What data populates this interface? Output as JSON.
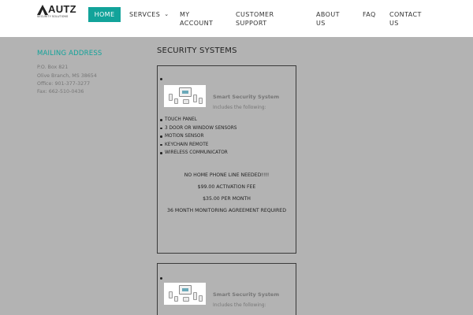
{
  "header": {
    "logo_text": "AUTZ",
    "logo_sub": "SECURITY SOLUTIONS",
    "nav": [
      "HOME",
      "SERVCES",
      "MY ACCOUNT",
      "CUSTOMER SUPPORT",
      "ABOUT US",
      "FAQ",
      "CONTACT US"
    ]
  },
  "sidebar": {
    "title": "MAILING ADDRESS",
    "lines": [
      "P.O. Box 821",
      "Olive Branch, MS 38654",
      "Office: 901-377-3277",
      "Fax: 662-510-0436"
    ]
  },
  "main": {
    "title": "SECURITY SYSTEMS",
    "product": {
      "name": "Smart Security System",
      "subtitle": "Includes the following:",
      "features": [
        "TOUCH PANEL",
        "3 DOOR OR WINDOW SENSORS",
        "MOTION SENSOR",
        "KEYCHAIN REMOTE",
        "WIRELESS COMMUNICATOR"
      ],
      "notes": [
        "NO HOME PHONE LINE NEEDED!!!!",
        "$99.00 ACTIVATION FEE",
        "$35.00 PER MONTH",
        "36 MONTH MONITORING AGREEMENT REQUIRED"
      ]
    }
  },
  "colors": {
    "accent": "#12a39a",
    "page_bg": "#b3b3b3",
    "header_bg": "#ffffff"
  }
}
